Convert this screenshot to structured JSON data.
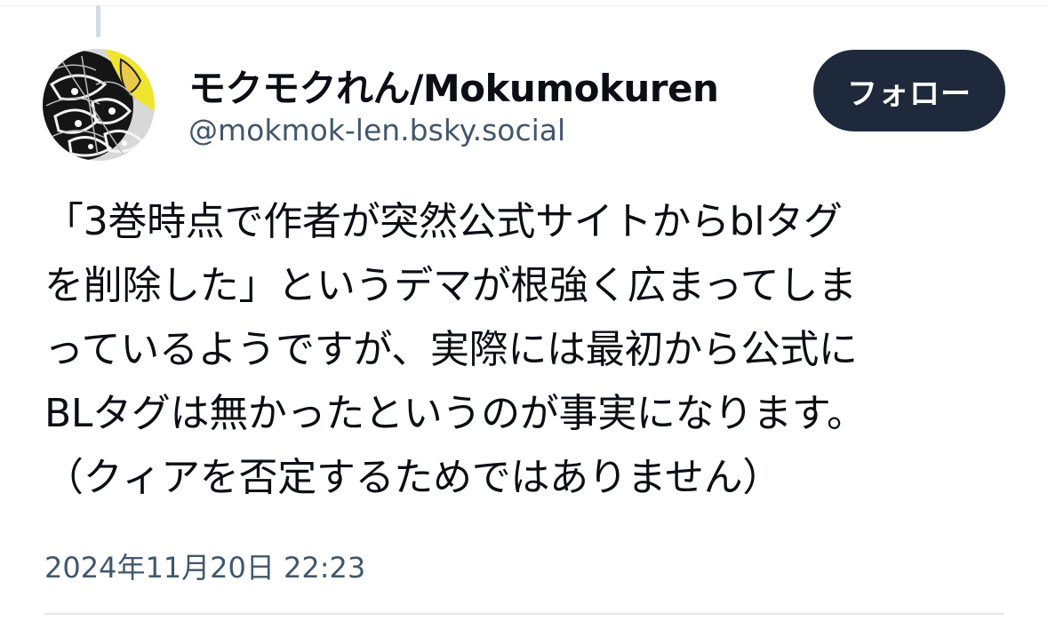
{
  "post": {
    "author": {
      "display_name": "モクモクれん/Mokumokuren",
      "handle": "@mokmok-len.bsky.social",
      "avatar_icon": "avatar-image"
    },
    "follow_button_label": "フォロー",
    "text_lines": [
      "「3巻時点で作者が突然公式サイトからblタグ",
      "を削除した」というデマが根強く広まってしま",
      "っているようですが、実際には最初から公式に",
      "BLタグは無かったというのが事実になります。",
      "（クィアを否定するためではありません）"
    ],
    "timestamp": "2024年11月20日 22:23"
  },
  "colors": {
    "text": "#0b0f14",
    "secondary_text": "#42576c",
    "follow_button_bg": "#1e2a3b",
    "follow_button_text": "#ffffff",
    "thread_line": "#d4dbe2",
    "divider": "#e3e8ee"
  }
}
